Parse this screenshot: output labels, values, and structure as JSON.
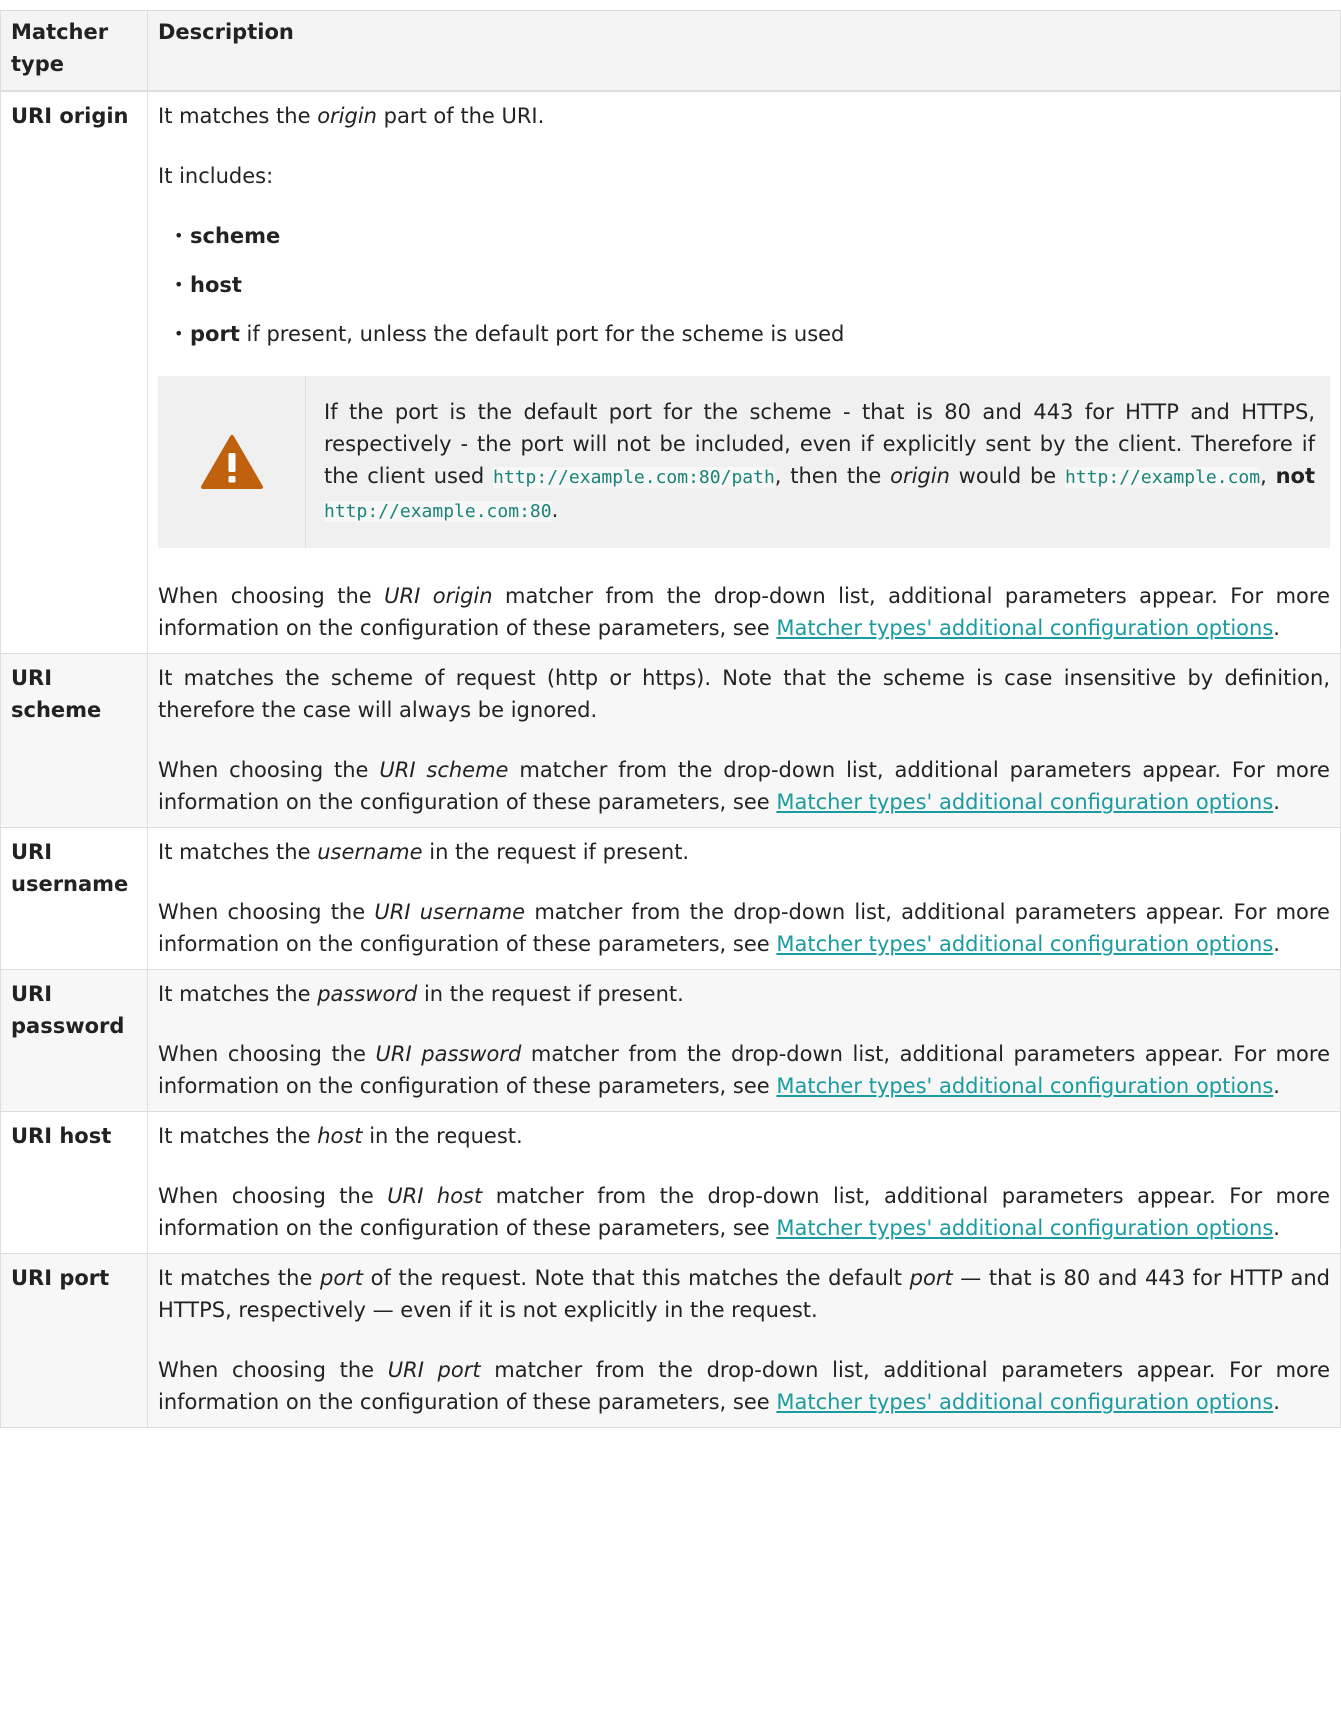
{
  "table": {
    "headers": {
      "type": "Matcher type",
      "description": "Description"
    },
    "rows": [
      {
        "type": "URI origin",
        "intro_before": "It matches the ",
        "intro_em": "origin",
        "intro_after": " part of the URI.",
        "includes_label": "It includes:",
        "items": [
          {
            "bold": "scheme",
            "rest": ""
          },
          {
            "bold": "host",
            "rest": ""
          },
          {
            "bold": "port",
            "rest": " if present, unless the default port for the scheme is used"
          }
        ],
        "warning": {
          "icon": "warning-triangle-icon",
          "text1": "If the port is the default port for the scheme - that is 80 and 443 for HTTP and HTTPS, respectively - the port will not be included, even if explicitly sent by the client. Therefore if the client used ",
          "code1": "http://example.com:80/path",
          "text2": ", then the ",
          "em": "origin",
          "text3": " would be ",
          "code2": "http://example.com",
          "text4": ", ",
          "bold": "not",
          "text5": " ",
          "code3": "http://example.com:80",
          "text6": "."
        },
        "choose_before": "When choosing the ",
        "choose_em": "URI origin",
        "choose_after": " matcher from the drop-down list, additional parameters appear. For more information on the configuration of these parameters, see ",
        "link": "Matcher types' additional configuration options",
        "choose_end": "."
      },
      {
        "type": "URI scheme",
        "intro": "It matches the scheme of request (http or https). Note that the scheme is case insensitive by definition, therefore the case will always be ignored.",
        "choose_before": "When choosing the ",
        "choose_em": "URI scheme",
        "choose_after": " matcher from the drop-down list, additional parameters appear. For more information on the configuration of these parameters, see ",
        "link": "Matcher types' additional configuration options",
        "choose_end": "."
      },
      {
        "type": "URI username",
        "intro_before": "It matches the ",
        "intro_em": "username",
        "intro_after": " in the request if present.",
        "choose_before": "When choosing the ",
        "choose_em": "URI username",
        "choose_after": " matcher from the drop-down list, additional parameters appear. For more information on the configuration of these parameters, see ",
        "link": "Matcher types' additional configuration options",
        "choose_end": "."
      },
      {
        "type": "URI password",
        "intro_before": "It matches the ",
        "intro_em": "password",
        "intro_after": " in the request if present.",
        "choose_before": "When choosing the ",
        "choose_em": "URI password",
        "choose_after": " matcher from the drop-down list, additional parameters appear. For more information on the configuration of these parameters, see ",
        "link": "Matcher types' additional configuration options",
        "choose_end": "."
      },
      {
        "type": "URI host",
        "intro_before": "It matches the ",
        "intro_em": "host",
        "intro_after": " in the request.",
        "choose_before": "When choosing the ",
        "choose_em": "URI host",
        "choose_after": " matcher from the drop-down list, additional parameters appear. For more information on the configuration of these parameters, see ",
        "link": "Matcher types' additional configuration options",
        "choose_end": "."
      },
      {
        "type": "URI port",
        "intro_before": "It matches the ",
        "intro_em": "port",
        "intro_mid": " of the request. Note that this matches the default ",
        "intro_em2": "port",
        "intro_after": " — that is 80 and 443 for HTTP and HTTPS, respectively — even if it is not explicitly in the request.",
        "choose_before": "When choosing the ",
        "choose_em": "URI port",
        "choose_after": " matcher from the drop-down list, additional parameters appear. For more information on the configuration of these parameters, see ",
        "link": "Matcher types' additional configuration options",
        "choose_end": "."
      }
    ]
  },
  "colors": {
    "warning_icon": "#c0620d",
    "link": "#1a9ba0",
    "code": "#19837a",
    "header_bg": "#f4f4f4",
    "stripe_bg": "#f7f7f7"
  }
}
